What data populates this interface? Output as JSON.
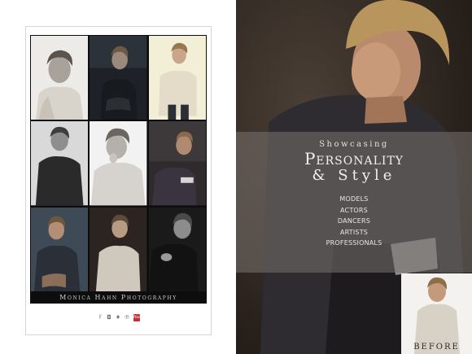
{
  "composite": {
    "footer_name": "Monica Hahn Photography",
    "social_icons": [
      {
        "name": "facebook-icon",
        "glyph": "f"
      },
      {
        "name": "instagram-icon",
        "glyph": "◘"
      },
      {
        "name": "twitter-icon",
        "glyph": "♦"
      },
      {
        "name": "pinterest-icon",
        "glyph": "℗"
      },
      {
        "name": "youtube-icon",
        "glyph": "You"
      }
    ]
  },
  "hero": {
    "eyebrow": "Showcasing",
    "headline": "Personality",
    "subline": "& Style",
    "menu": [
      "MODELS",
      "ACTORS",
      "DANCERS",
      "ARTISTS",
      "PROFESSIONALS"
    ],
    "before_label": "BEFORE"
  },
  "colors": {
    "banner_overlay": "#7a7572",
    "card_border": "#d6d6d6",
    "youtube_red": "#c4302b"
  }
}
